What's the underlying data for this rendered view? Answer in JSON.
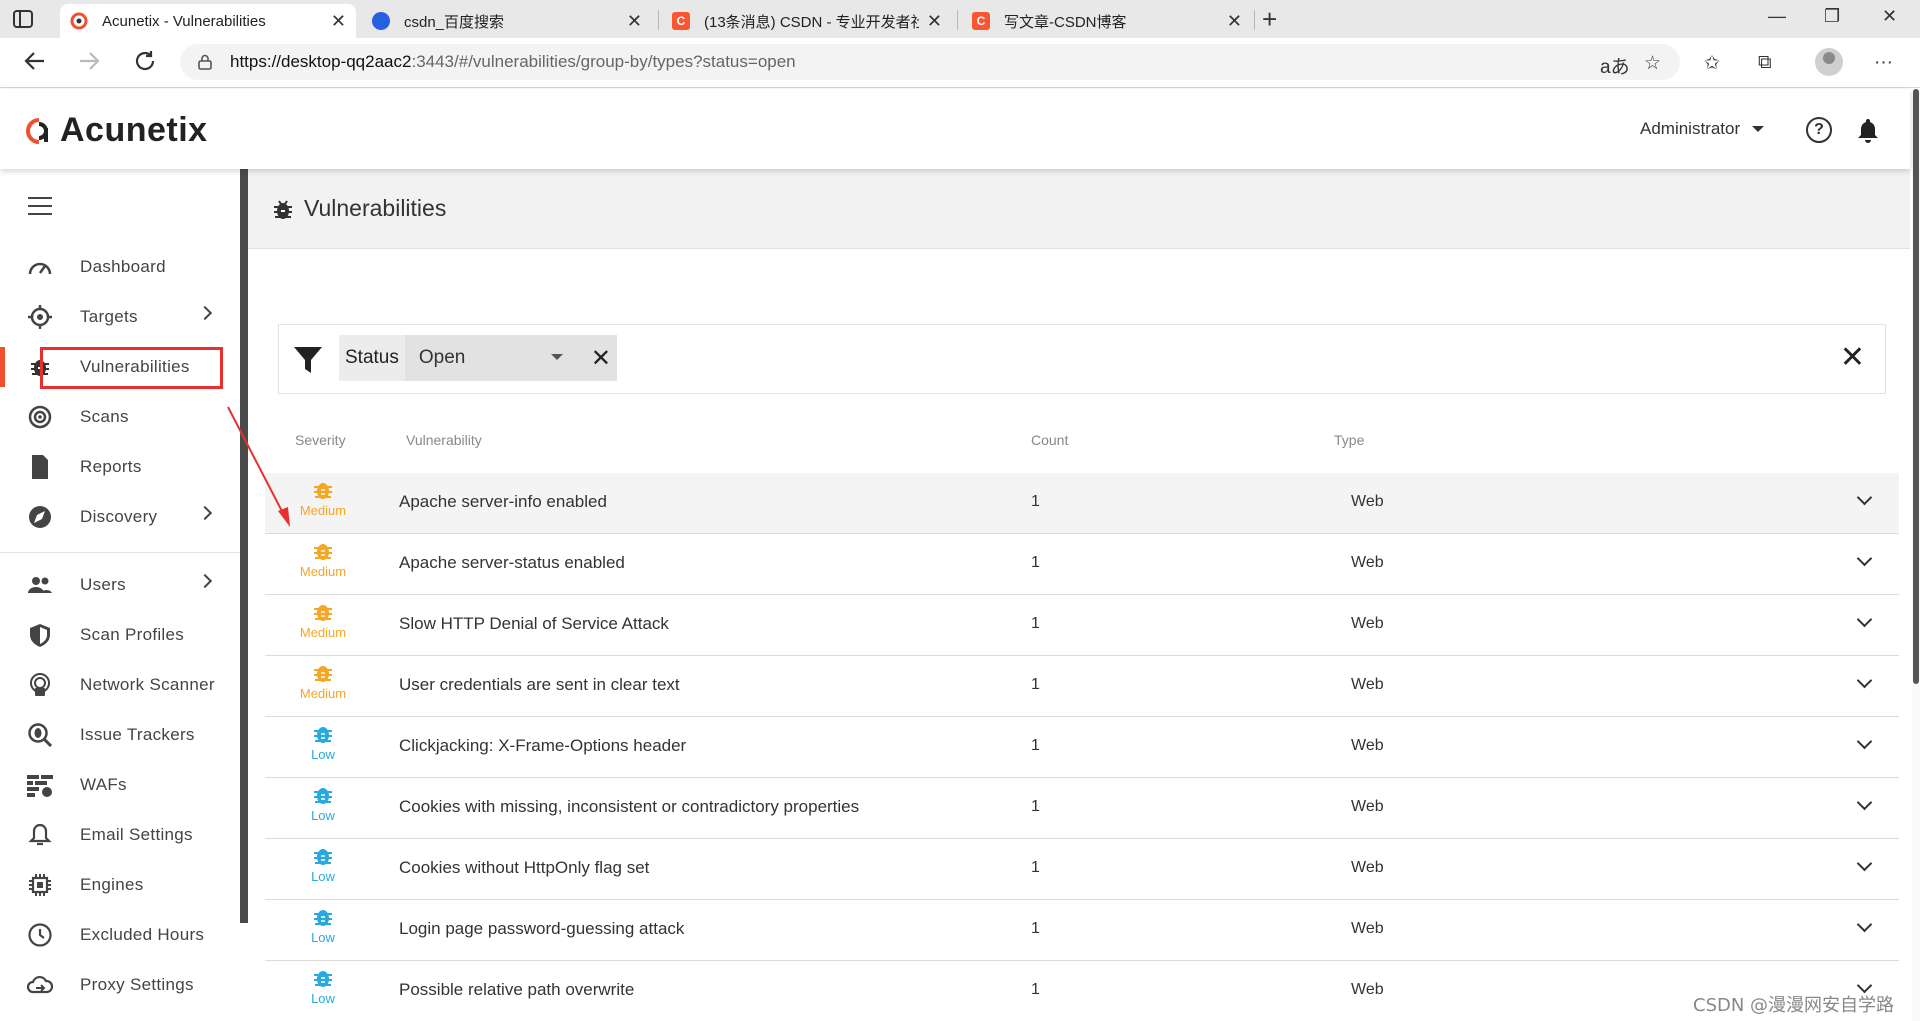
{
  "browser": {
    "tabs": [
      {
        "title": "Acunetix - Vulnerabilities",
        "favicon_color": "#ffffff",
        "active": true
      },
      {
        "title": "csdn_百度搜索",
        "favicon_color": "#2b5de8",
        "active": false
      },
      {
        "title": "(13条消息) CSDN - 专业开发者社",
        "favicon_color": "#fc5531",
        "active": false
      },
      {
        "title": "写文章-CSDN博客",
        "favicon_color": "#fc5531",
        "active": false
      }
    ],
    "close_glyph": "✕",
    "new_tab_glyph": "+",
    "url_host": "https://desktop-qq2aac2",
    "url_rest": ":3443/#/vulnerabilities/group-by/types?status=open",
    "window_controls": [
      "—",
      "❐",
      "✕"
    ]
  },
  "header": {
    "logo_text": "Acunetix",
    "user_label": "Administrator",
    "help_glyph": "?"
  },
  "sidebar": {
    "items": [
      {
        "label": "Dashboard",
        "icon": "dashboard-icon",
        "chevron": false
      },
      {
        "label": "Targets",
        "icon": "target-icon",
        "chevron": true
      },
      {
        "label": "Vulnerabilities",
        "icon": "bug-icon",
        "chevron": false,
        "active": true
      },
      {
        "label": "Scans",
        "icon": "scan-icon",
        "chevron": false
      },
      {
        "label": "Reports",
        "icon": "report-icon",
        "chevron": false
      },
      {
        "label": "Discovery",
        "icon": "compass-icon",
        "chevron": true
      },
      {
        "label": "Users",
        "icon": "users-icon",
        "chevron": true
      },
      {
        "label": "Scan Profiles",
        "icon": "shield-icon",
        "chevron": false
      },
      {
        "label": "Network Scanner",
        "icon": "network-scanner-icon",
        "chevron": false
      },
      {
        "label": "Issue Trackers",
        "icon": "issue-tracker-icon",
        "chevron": false
      },
      {
        "label": "WAFs",
        "icon": "waf-icon",
        "chevron": false
      },
      {
        "label": "Email Settings",
        "icon": "bell-icon",
        "chevron": false
      },
      {
        "label": "Engines",
        "icon": "chip-icon",
        "chevron": false
      },
      {
        "label": "Excluded Hours",
        "icon": "clock-icon",
        "chevron": false
      },
      {
        "label": "Proxy Settings",
        "icon": "cloud-icon",
        "chevron": false
      }
    ]
  },
  "page": {
    "title": "Vulnerabilities",
    "filter": {
      "label": "Status",
      "value": "Open",
      "remove_glyph": "✕",
      "clear_glyph": "✕"
    },
    "columns": {
      "severity": "Severity",
      "vulnerability": "Vulnerability",
      "count": "Count",
      "type": "Type"
    },
    "colors": {
      "medium": "#f5a623",
      "low": "#29a9e0",
      "accent": "#f0502d",
      "highlight": "#e8312f"
    },
    "rows": [
      {
        "severity": "Medium",
        "name": "Apache server-info enabled",
        "count": "1",
        "type": "Web"
      },
      {
        "severity": "Medium",
        "name": "Apache server-status enabled",
        "count": "1",
        "type": "Web"
      },
      {
        "severity": "Medium",
        "name": "Slow HTTP Denial of Service Attack",
        "count": "1",
        "type": "Web"
      },
      {
        "severity": "Medium",
        "name": "User credentials are sent in clear text",
        "count": "1",
        "type": "Web"
      },
      {
        "severity": "Low",
        "name": "Clickjacking: X-Frame-Options header",
        "count": "1",
        "type": "Web"
      },
      {
        "severity": "Low",
        "name": "Cookies with missing, inconsistent or contradictory properties",
        "count": "1",
        "type": "Web"
      },
      {
        "severity": "Low",
        "name": "Cookies without HttpOnly flag set",
        "count": "1",
        "type": "Web"
      },
      {
        "severity": "Low",
        "name": "Login page password-guessing attack",
        "count": "1",
        "type": "Web"
      },
      {
        "severity": "Low",
        "name": "Possible relative path overwrite",
        "count": "1",
        "type": "Web"
      }
    ]
  },
  "watermark": "CSDN @漫漫网安自学路"
}
